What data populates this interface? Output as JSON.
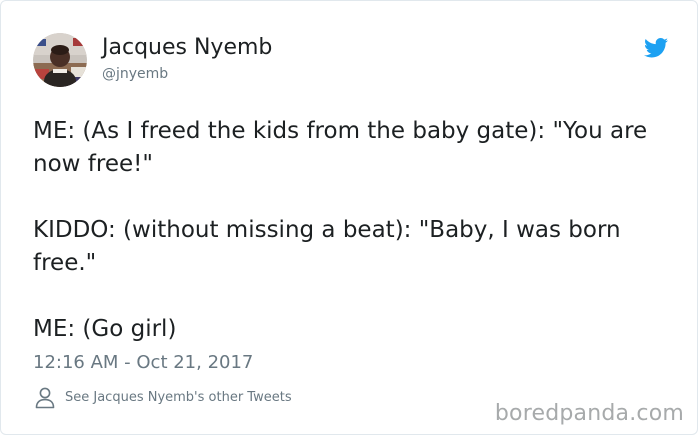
{
  "tweet": {
    "author_name": "Jacques Nyemb",
    "author_handle": "@jnyemb",
    "paragraphs": [
      "ME: (As I freed the kids from the baby gate): \"You are now free!\"",
      "KIDDO: (without missing a beat): \"Baby, I was born free.\"",
      "ME: (Go girl)"
    ],
    "timestamp": "12:16 AM - Oct 21, 2017",
    "other_tweets_link": "See Jacques Nyemb's other Tweets",
    "avatar_icon": "profile-photo",
    "platform_icon": "twitter-bird-icon",
    "person_icon": "person-outline-icon"
  },
  "watermark": {
    "text": "boredpanda.com"
  },
  "colors": {
    "accent": "#1da1f2",
    "text_primary": "#1c2022",
    "text_secondary": "#697882",
    "border": "#e1e8ed",
    "watermark": "#a7aaab"
  }
}
